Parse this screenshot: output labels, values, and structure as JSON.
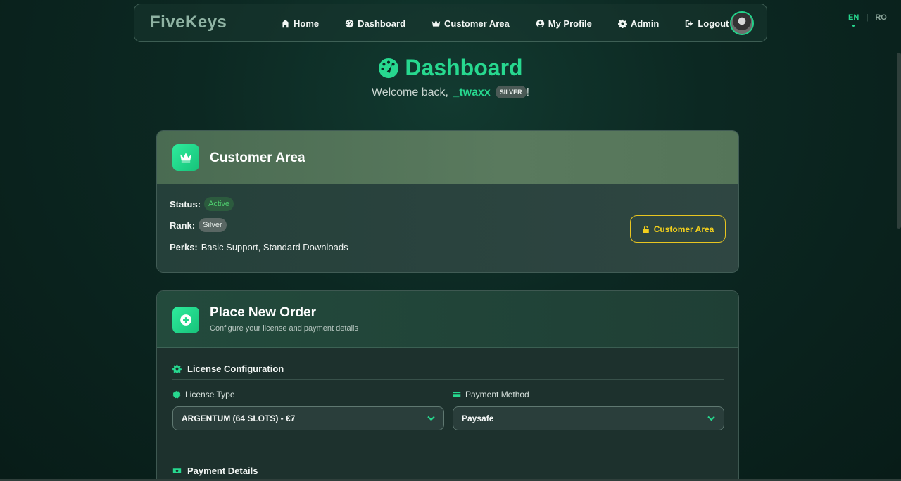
{
  "brand": "FiveKeys",
  "nav": {
    "items": [
      {
        "label": "Home",
        "icon": "home-icon"
      },
      {
        "label": "Dashboard",
        "icon": "dashboard-icon"
      },
      {
        "label": "Customer Area",
        "icon": "crown-icon"
      },
      {
        "label": "My Profile",
        "icon": "user-circle-icon"
      },
      {
        "label": "Admin",
        "icon": "gear-icon"
      },
      {
        "label": "Logout",
        "icon": "logout-icon"
      }
    ]
  },
  "language": {
    "active": "EN",
    "other": "RO"
  },
  "header": {
    "title": "Dashboard",
    "welcome_prefix": "Welcome back, ",
    "username": "_twaxx",
    "rank_badge": "SILVER",
    "welcome_suffix": "!"
  },
  "customer_area": {
    "title": "Customer Area",
    "status_label": "Status:",
    "status_value": "Active",
    "rank_label": "Rank:",
    "rank_value": "Silver",
    "perks_label": "Perks:",
    "perks_value": "Basic Support, Standard Downloads",
    "button_label": "Customer Area"
  },
  "order": {
    "title": "Place New Order",
    "subtitle": "Configure your license and payment details",
    "license_section": "License Configuration",
    "license_type_label": "License Type",
    "license_type_value": "ARGENTUM (64 SLOTS) - €7",
    "payment_method_label": "Payment Method",
    "payment_method_value": "Paysafe",
    "payment_details_section": "Payment Details"
  },
  "colors": {
    "accent": "#27d88f",
    "button_gold": "#f2cf1c",
    "background": "#0c2822"
  }
}
